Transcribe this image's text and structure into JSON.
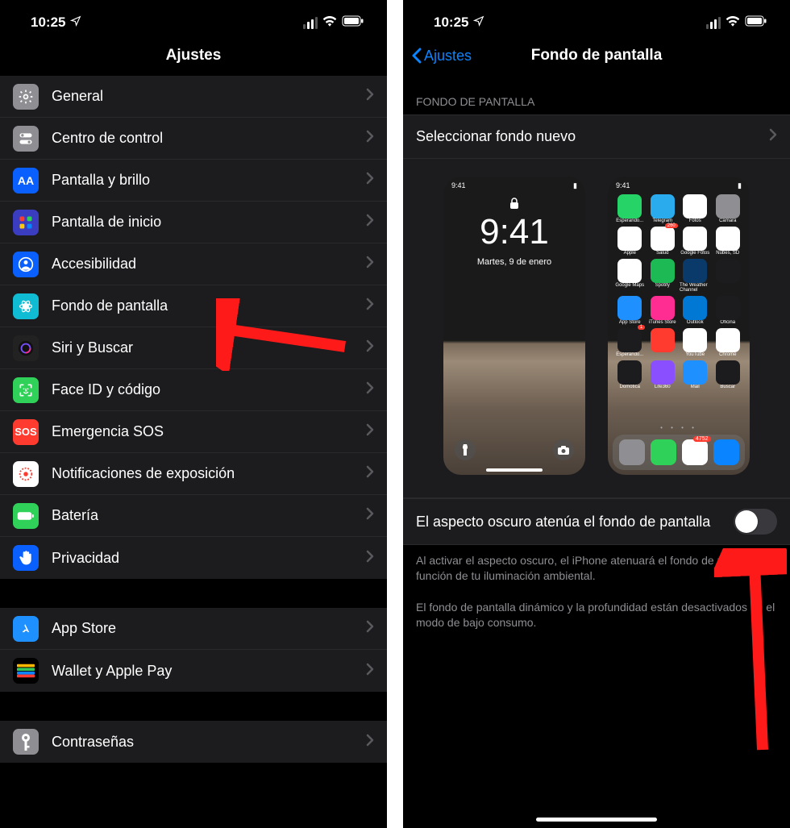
{
  "status": {
    "time": "10:25"
  },
  "screen1": {
    "title": "Ajustes",
    "items_a": [
      {
        "label": "General",
        "icon_bg": "#8e8e93",
        "icon": "gear"
      },
      {
        "label": "Centro de control",
        "icon_bg": "#8e8e93",
        "icon": "toggles"
      },
      {
        "label": "Pantalla y brillo",
        "icon_bg": "#0a60ff",
        "icon": "aa"
      },
      {
        "label": "Pantalla de inicio",
        "icon_bg": "#3a3dbf",
        "icon": "grid"
      },
      {
        "label": "Accesibilidad",
        "icon_bg": "#0a60ff",
        "icon": "person"
      },
      {
        "label": "Fondo de pantalla",
        "icon_bg": "#10bcd4",
        "icon": "flower"
      },
      {
        "label": "Siri y Buscar",
        "icon_bg": "#222",
        "icon": "siri"
      },
      {
        "label": "Face ID y código",
        "icon_bg": "#30d158",
        "icon": "face"
      },
      {
        "label": "Emergencia SOS",
        "icon_bg": "#ff3b30",
        "icon": "sos"
      },
      {
        "label": "Notificaciones de exposición",
        "icon_bg": "#fff",
        "icon": "exposure"
      },
      {
        "label": "Batería",
        "icon_bg": "#30d158",
        "icon": "battery"
      },
      {
        "label": "Privacidad",
        "icon_bg": "#0a60ff",
        "icon": "hand"
      }
    ],
    "items_b": [
      {
        "label": "App Store",
        "icon_bg": "#1e90ff",
        "icon": "appstore"
      },
      {
        "label": "Wallet y Apple Pay",
        "icon_bg": "#222",
        "icon": "wallet"
      }
    ],
    "items_c": [
      {
        "label": "Contraseñas",
        "icon_bg": "#8e8e93",
        "icon": "key"
      }
    ]
  },
  "screen2": {
    "back": "Ajustes",
    "title": "Fondo de pantalla",
    "section_header": "Fondo de pantalla",
    "select_new": "Seleccionar fondo nuevo",
    "lock_preview": {
      "time": "9:41",
      "date": "Martes, 9 de enero",
      "mini_time": "9:41"
    },
    "home_preview": {
      "mini_time": "9:41",
      "apps": [
        {
          "name": "Esperando...",
          "bg": "#25d366"
        },
        {
          "name": "Telegram",
          "bg": "#2aabee"
        },
        {
          "name": "Fotos",
          "bg": "#fff"
        },
        {
          "name": "Cámara",
          "bg": "#8e8e93"
        },
        {
          "name": "Apple",
          "bg": "#fff"
        },
        {
          "name": "Salud",
          "bg": "#fff"
        },
        {
          "name": "Google Fotos",
          "bg": "#fff"
        },
        {
          "name": "Nubes, SD",
          "bg": "#fff"
        },
        {
          "name": "Google Maps",
          "bg": "#fff"
        },
        {
          "name": "Spotify",
          "bg": "#1db954"
        },
        {
          "name": "The Weather Channel",
          "bg": "#0a3a6a"
        },
        {
          "name": "",
          "bg": "#1c1c1e"
        },
        {
          "name": "App Store",
          "bg": "#1e90ff"
        },
        {
          "name": "iTunes Store",
          "bg": "#ff2d92"
        },
        {
          "name": "Outlook",
          "bg": "#0078d4"
        },
        {
          "name": "Oficina",
          "bg": "#1c1c1e"
        },
        {
          "name": "Esperando...",
          "bg": "#1c1c1e"
        },
        {
          "name": "",
          "bg": "#ff3b30"
        },
        {
          "name": "YouTube",
          "bg": "#fff"
        },
        {
          "name": "Chrome",
          "bg": "#fff"
        },
        {
          "name": "Domótica",
          "bg": "#1c1c1e"
        },
        {
          "name": "Life360",
          "bg": "#8a4fff"
        },
        {
          "name": "Mail",
          "bg": "#1e90ff"
        },
        {
          "name": "Buscar",
          "bg": "#1c1c1e"
        }
      ],
      "dock": [
        {
          "bg": "#8e8e93"
        },
        {
          "bg": "#30d158"
        },
        {
          "bg": "#fff"
        },
        {
          "bg": "#0a84ff"
        }
      ],
      "badge_salud": "260",
      "badge_mail": "4752",
      "badge_esperando": "1"
    },
    "toggle_label": "El aspecto oscuro atenúa el fondo de pantalla",
    "footer1": "Al activar el aspecto oscuro, el iPhone atenuará el fondo de pantalla en función de tu iluminación ambiental.",
    "footer2": "El fondo de pantalla dinámico y la profundidad están desactivados en el modo de bajo consumo."
  }
}
